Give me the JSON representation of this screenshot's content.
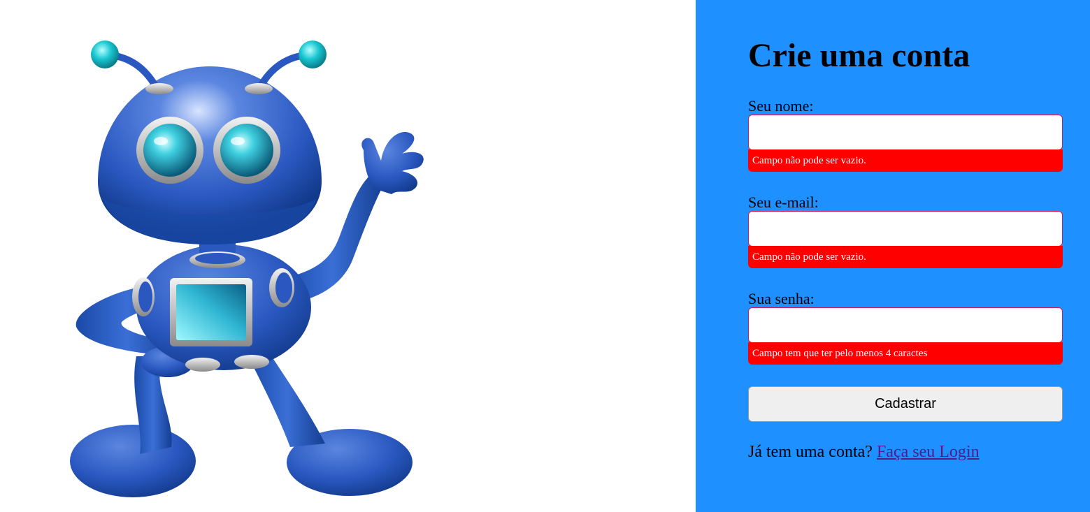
{
  "form": {
    "title": "Crie uma conta",
    "fields": [
      {
        "label": "Seu nome:",
        "value": "",
        "placeholder": "",
        "error": "Campo não pode ser vazio."
      },
      {
        "label": "Seu e-mail:",
        "value": "",
        "placeholder": "",
        "error": "Campo não pode ser vazio."
      },
      {
        "label": "Sua senha:",
        "value": "",
        "placeholder": "",
        "error": "Campo tem que ter pelo menos 4 caractes"
      }
    ],
    "submit_label": "Cadastrar",
    "login_prompt": "Já tem uma conta?",
    "login_link": "Faça seu Login"
  },
  "colors": {
    "panel_background": "#1e90ff",
    "error_background": "#ff0000",
    "error_text": "#ffffff",
    "input_border": "#d6184f",
    "link": "#551a8b",
    "robot_body": "#2f62c4",
    "robot_accent": "#1ec8d8"
  },
  "illustration": {
    "icon": "robot-mascot-icon"
  }
}
